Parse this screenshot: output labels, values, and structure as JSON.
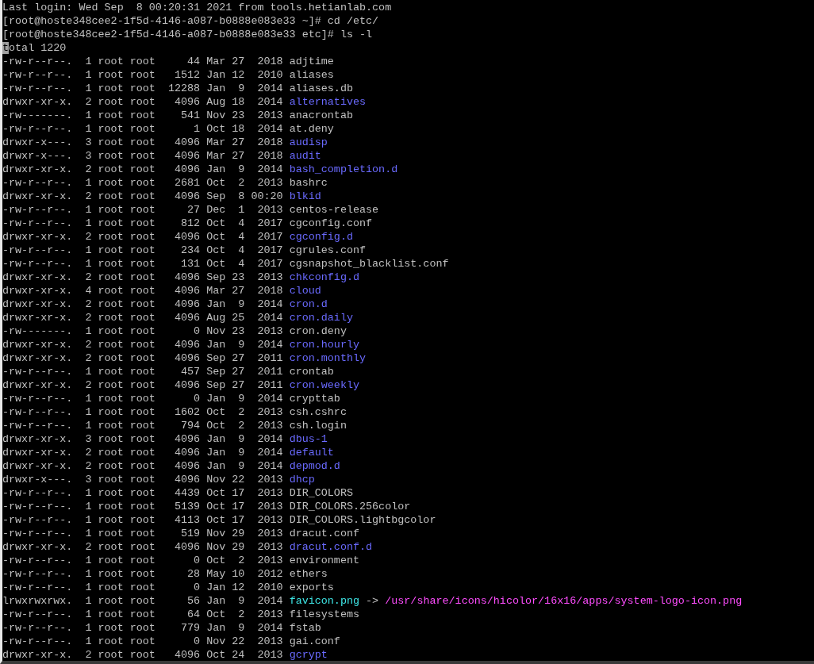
{
  "lines": [
    {
      "text": "Last login: Wed Sep  8 00:20:31 2021 from tools.hetianlab.com",
      "cursor": false
    },
    {
      "text": "[root@hoste348cee2-1f5d-4146-a087-b0888e083e33 ~]# cd /etc/",
      "cursor": false
    },
    {
      "text": "[root@hoste348cee2-1f5d-4146-a087-b0888e083e33 etc]# ls -l",
      "cursor": false
    },
    {
      "text": "total 1220",
      "cursor": true
    }
  ],
  "listing": [
    {
      "permissions": "-rw-r--r--.",
      "links": "1",
      "owner": "root",
      "group": "root",
      "size": "44",
      "month": "Mar",
      "day": "27",
      "time": "2018",
      "name": "adjtime",
      "kind": "file"
    },
    {
      "permissions": "-rw-r--r--.",
      "links": "1",
      "owner": "root",
      "group": "root",
      "size": "1512",
      "month": "Jan",
      "day": "12",
      "time": "2010",
      "name": "aliases",
      "kind": "file"
    },
    {
      "permissions": "-rw-r--r--.",
      "links": "1",
      "owner": "root",
      "group": "root",
      "size": "12288",
      "month": "Jan",
      "day": "9",
      "time": "2014",
      "name": "aliases.db",
      "kind": "file"
    },
    {
      "permissions": "drwxr-xr-x.",
      "links": "2",
      "owner": "root",
      "group": "root",
      "size": "4096",
      "month": "Aug",
      "day": "18",
      "time": "2014",
      "name": "alternatives",
      "kind": "dir"
    },
    {
      "permissions": "-rw-------.",
      "links": "1",
      "owner": "root",
      "group": "root",
      "size": "541",
      "month": "Nov",
      "day": "23",
      "time": "2013",
      "name": "anacrontab",
      "kind": "file"
    },
    {
      "permissions": "-rw-r--r--.",
      "links": "1",
      "owner": "root",
      "group": "root",
      "size": "1",
      "month": "Oct",
      "day": "18",
      "time": "2014",
      "name": "at.deny",
      "kind": "file"
    },
    {
      "permissions": "drwxr-x---.",
      "links": "3",
      "owner": "root",
      "group": "root",
      "size": "4096",
      "month": "Mar",
      "day": "27",
      "time": "2018",
      "name": "audisp",
      "kind": "dir"
    },
    {
      "permissions": "drwxr-x---.",
      "links": "3",
      "owner": "root",
      "group": "root",
      "size": "4096",
      "month": "Mar",
      "day": "27",
      "time": "2018",
      "name": "audit",
      "kind": "dir"
    },
    {
      "permissions": "drwxr-xr-x.",
      "links": "2",
      "owner": "root",
      "group": "root",
      "size": "4096",
      "month": "Jan",
      "day": "9",
      "time": "2014",
      "name": "bash_completion.d",
      "kind": "dir"
    },
    {
      "permissions": "-rw-r--r--.",
      "links": "1",
      "owner": "root",
      "group": "root",
      "size": "2681",
      "month": "Oct",
      "day": "2",
      "time": "2013",
      "name": "bashrc",
      "kind": "file"
    },
    {
      "permissions": "drwxr-xr-x.",
      "links": "2",
      "owner": "root",
      "group": "root",
      "size": "4096",
      "month": "Sep",
      "day": "8",
      "time": "00:20",
      "name": "blkid",
      "kind": "dir"
    },
    {
      "permissions": "-rw-r--r--.",
      "links": "1",
      "owner": "root",
      "group": "root",
      "size": "27",
      "month": "Dec",
      "day": "1",
      "time": "2013",
      "name": "centos-release",
      "kind": "file"
    },
    {
      "permissions": "-rw-r--r--.",
      "links": "1",
      "owner": "root",
      "group": "root",
      "size": "812",
      "month": "Oct",
      "day": "4",
      "time": "2017",
      "name": "cgconfig.conf",
      "kind": "file"
    },
    {
      "permissions": "drwxr-xr-x.",
      "links": "2",
      "owner": "root",
      "group": "root",
      "size": "4096",
      "month": "Oct",
      "day": "4",
      "time": "2017",
      "name": "cgconfig.d",
      "kind": "dir"
    },
    {
      "permissions": "-rw-r--r--.",
      "links": "1",
      "owner": "root",
      "group": "root",
      "size": "234",
      "month": "Oct",
      "day": "4",
      "time": "2017",
      "name": "cgrules.conf",
      "kind": "file"
    },
    {
      "permissions": "-rw-r--r--.",
      "links": "1",
      "owner": "root",
      "group": "root",
      "size": "131",
      "month": "Oct",
      "day": "4",
      "time": "2017",
      "name": "cgsnapshot_blacklist.conf",
      "kind": "file"
    },
    {
      "permissions": "drwxr-xr-x.",
      "links": "2",
      "owner": "root",
      "group": "root",
      "size": "4096",
      "month": "Sep",
      "day": "23",
      "time": "2013",
      "name": "chkconfig.d",
      "kind": "dir"
    },
    {
      "permissions": "drwxr-xr-x.",
      "links": "4",
      "owner": "root",
      "group": "root",
      "size": "4096",
      "month": "Mar",
      "day": "27",
      "time": "2018",
      "name": "cloud",
      "kind": "dir"
    },
    {
      "permissions": "drwxr-xr-x.",
      "links": "2",
      "owner": "root",
      "group": "root",
      "size": "4096",
      "month": "Jan",
      "day": "9",
      "time": "2014",
      "name": "cron.d",
      "kind": "dir"
    },
    {
      "permissions": "drwxr-xr-x.",
      "links": "2",
      "owner": "root",
      "group": "root",
      "size": "4096",
      "month": "Aug",
      "day": "25",
      "time": "2014",
      "name": "cron.daily",
      "kind": "dir"
    },
    {
      "permissions": "-rw-------.",
      "links": "1",
      "owner": "root",
      "group": "root",
      "size": "0",
      "month": "Nov",
      "day": "23",
      "time": "2013",
      "name": "cron.deny",
      "kind": "file"
    },
    {
      "permissions": "drwxr-xr-x.",
      "links": "2",
      "owner": "root",
      "group": "root",
      "size": "4096",
      "month": "Jan",
      "day": "9",
      "time": "2014",
      "name": "cron.hourly",
      "kind": "dir"
    },
    {
      "permissions": "drwxr-xr-x.",
      "links": "2",
      "owner": "root",
      "group": "root",
      "size": "4096",
      "month": "Sep",
      "day": "27",
      "time": "2011",
      "name": "cron.monthly",
      "kind": "dir"
    },
    {
      "permissions": "-rw-r--r--.",
      "links": "1",
      "owner": "root",
      "group": "root",
      "size": "457",
      "month": "Sep",
      "day": "27",
      "time": "2011",
      "name": "crontab",
      "kind": "file"
    },
    {
      "permissions": "drwxr-xr-x.",
      "links": "2",
      "owner": "root",
      "group": "root",
      "size": "4096",
      "month": "Sep",
      "day": "27",
      "time": "2011",
      "name": "cron.weekly",
      "kind": "dir"
    },
    {
      "permissions": "-rw-r--r--.",
      "links": "1",
      "owner": "root",
      "group": "root",
      "size": "0",
      "month": "Jan",
      "day": "9",
      "time": "2014",
      "name": "crypttab",
      "kind": "file"
    },
    {
      "permissions": "-rw-r--r--.",
      "links": "1",
      "owner": "root",
      "group": "root",
      "size": "1602",
      "month": "Oct",
      "day": "2",
      "time": "2013",
      "name": "csh.cshrc",
      "kind": "file"
    },
    {
      "permissions": "-rw-r--r--.",
      "links": "1",
      "owner": "root",
      "group": "root",
      "size": "794",
      "month": "Oct",
      "day": "2",
      "time": "2013",
      "name": "csh.login",
      "kind": "file"
    },
    {
      "permissions": "drwxr-xr-x.",
      "links": "3",
      "owner": "root",
      "group": "root",
      "size": "4096",
      "month": "Jan",
      "day": "9",
      "time": "2014",
      "name": "dbus-1",
      "kind": "dir"
    },
    {
      "permissions": "drwxr-xr-x.",
      "links": "2",
      "owner": "root",
      "group": "root",
      "size": "4096",
      "month": "Jan",
      "day": "9",
      "time": "2014",
      "name": "default",
      "kind": "dir"
    },
    {
      "permissions": "drwxr-xr-x.",
      "links": "2",
      "owner": "root",
      "group": "root",
      "size": "4096",
      "month": "Jan",
      "day": "9",
      "time": "2014",
      "name": "depmod.d",
      "kind": "dir"
    },
    {
      "permissions": "drwxr-x---.",
      "links": "3",
      "owner": "root",
      "group": "root",
      "size": "4096",
      "month": "Nov",
      "day": "22",
      "time": "2013",
      "name": "dhcp",
      "kind": "dir"
    },
    {
      "permissions": "-rw-r--r--.",
      "links": "1",
      "owner": "root",
      "group": "root",
      "size": "4439",
      "month": "Oct",
      "day": "17",
      "time": "2013",
      "name": "DIR_COLORS",
      "kind": "file"
    },
    {
      "permissions": "-rw-r--r--.",
      "links": "1",
      "owner": "root",
      "group": "root",
      "size": "5139",
      "month": "Oct",
      "day": "17",
      "time": "2013",
      "name": "DIR_COLORS.256color",
      "kind": "file"
    },
    {
      "permissions": "-rw-r--r--.",
      "links": "1",
      "owner": "root",
      "group": "root",
      "size": "4113",
      "month": "Oct",
      "day": "17",
      "time": "2013",
      "name": "DIR_COLORS.lightbgcolor",
      "kind": "file"
    },
    {
      "permissions": "-rw-r--r--.",
      "links": "1",
      "owner": "root",
      "group": "root",
      "size": "519",
      "month": "Nov",
      "day": "29",
      "time": "2013",
      "name": "dracut.conf",
      "kind": "file"
    },
    {
      "permissions": "drwxr-xr-x.",
      "links": "2",
      "owner": "root",
      "group": "root",
      "size": "4096",
      "month": "Nov",
      "day": "29",
      "time": "2013",
      "name": "dracut.conf.d",
      "kind": "dir"
    },
    {
      "permissions": "-rw-r--r--.",
      "links": "1",
      "owner": "root",
      "group": "root",
      "size": "0",
      "month": "Oct",
      "day": "2",
      "time": "2013",
      "name": "environment",
      "kind": "file"
    },
    {
      "permissions": "-rw-r--r--.",
      "links": "1",
      "owner": "root",
      "group": "root",
      "size": "28",
      "month": "May",
      "day": "10",
      "time": "2012",
      "name": "ethers",
      "kind": "file"
    },
    {
      "permissions": "-rw-r--r--.",
      "links": "1",
      "owner": "root",
      "group": "root",
      "size": "0",
      "month": "Jan",
      "day": "12",
      "time": "2010",
      "name": "exports",
      "kind": "file"
    },
    {
      "permissions": "lrwxrwxrwx.",
      "links": "1",
      "owner": "root",
      "group": "root",
      "size": "56",
      "month": "Jan",
      "day": "9",
      "time": "2014",
      "name": "favicon.png",
      "kind": "link",
      "arrow": "->",
      "target": "/usr/share/icons/hicolor/16x16/apps/system-logo-icon.png"
    },
    {
      "permissions": "-rw-r--r--.",
      "links": "1",
      "owner": "root",
      "group": "root",
      "size": "64",
      "month": "Oct",
      "day": "2",
      "time": "2013",
      "name": "filesystems",
      "kind": "file"
    },
    {
      "permissions": "-rw-r--r--.",
      "links": "1",
      "owner": "root",
      "group": "root",
      "size": "779",
      "month": "Jan",
      "day": "9",
      "time": "2014",
      "name": "fstab",
      "kind": "file"
    },
    {
      "permissions": "-rw-r--r--.",
      "links": "1",
      "owner": "root",
      "group": "root",
      "size": "0",
      "month": "Nov",
      "day": "22",
      "time": "2013",
      "name": "gai.conf",
      "kind": "file"
    },
    {
      "permissions": "drwxr-xr-x.",
      "links": "2",
      "owner": "root",
      "group": "root",
      "size": "4096",
      "month": "Oct",
      "day": "24",
      "time": "2013",
      "name": "gcrypt",
      "kind": "dir"
    }
  ]
}
